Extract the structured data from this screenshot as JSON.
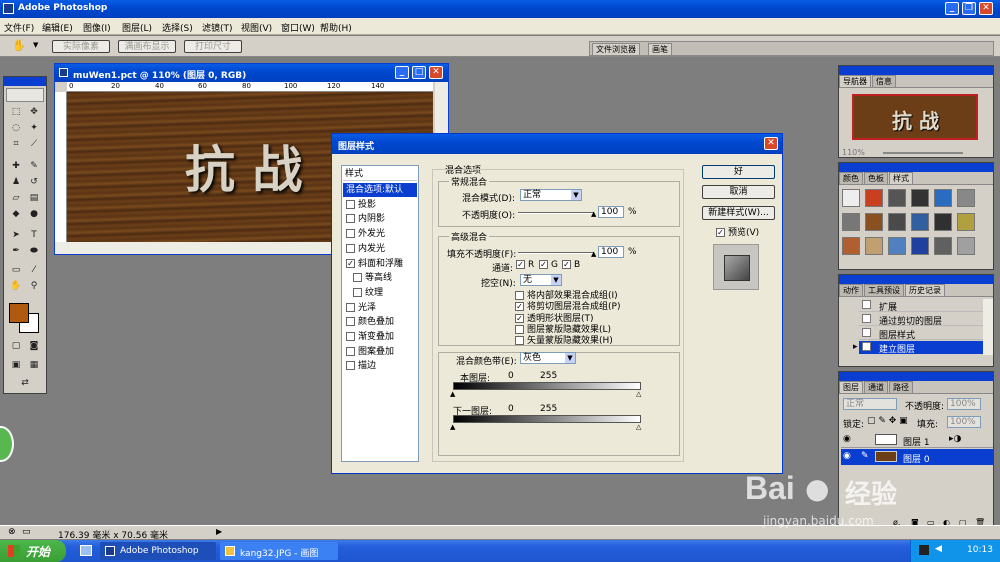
{
  "app": {
    "title": "Adobe Photoshop"
  },
  "menu": [
    "文件(F)",
    "编辑(E)",
    "图像(I)",
    "图层(L)",
    "选择(S)",
    "滤镜(T)",
    "视图(V)",
    "窗口(W)",
    "帮助(H)"
  ],
  "options": {
    "actual_pixels": "实际像素",
    "fit_screen": "满画布显示",
    "print_size": "打印尺寸",
    "file_browser": "文件浏览器",
    "brushes": "画笔"
  },
  "document": {
    "title": "muWen1.pct @ 110% (图层 0, RGB)",
    "ruler": [
      "0",
      "20",
      "40",
      "60",
      "80",
      "100",
      "120",
      "140"
    ],
    "text": "抗 战"
  },
  "dialog": {
    "title": "图层样式",
    "styles_header": "样式",
    "styles": [
      {
        "label": "混合选项:默认",
        "checked": null,
        "selected": true,
        "indent": false
      },
      {
        "label": "投影",
        "checked": false,
        "selected": false,
        "indent": false
      },
      {
        "label": "内阴影",
        "checked": false,
        "selected": false,
        "indent": false
      },
      {
        "label": "外发光",
        "checked": false,
        "selected": false,
        "indent": false
      },
      {
        "label": "内发光",
        "checked": false,
        "selected": false,
        "indent": false
      },
      {
        "label": "斜面和浮雕",
        "checked": true,
        "selected": false,
        "indent": false
      },
      {
        "label": "等高线",
        "checked": false,
        "selected": false,
        "indent": true
      },
      {
        "label": "纹理",
        "checked": false,
        "selected": false,
        "indent": true
      },
      {
        "label": "光泽",
        "checked": false,
        "selected": false,
        "indent": false
      },
      {
        "label": "颜色叠加",
        "checked": false,
        "selected": false,
        "indent": false
      },
      {
        "label": "渐变叠加",
        "checked": false,
        "selected": false,
        "indent": false
      },
      {
        "label": "图案叠加",
        "checked": false,
        "selected": false,
        "indent": false
      },
      {
        "label": "描边",
        "checked": false,
        "selected": false,
        "indent": false
      }
    ],
    "blend_options": "混合选项",
    "general_blending": "常规混合",
    "blend_mode_label": "混合模式(D):",
    "blend_mode": "正常",
    "opacity_label": "不透明度(O):",
    "opacity": "100",
    "advanced_blending": "高级混合",
    "fill_opacity_label": "填充不透明度(F):",
    "fill_opacity": "100",
    "percent": "%",
    "channels_label": "通道:",
    "channels": [
      "R",
      "G",
      "B"
    ],
    "knockout_label": "挖空(N):",
    "knockout": "无",
    "adv_options": [
      {
        "label": "将内部效果混合成组(I)",
        "checked": false
      },
      {
        "label": "将剪切图层混合成组(P)",
        "checked": true
      },
      {
        "label": "透明形状图层(T)",
        "checked": true
      },
      {
        "label": "图层蒙版隐藏效果(L)",
        "checked": false
      },
      {
        "label": "矢量蒙版隐藏效果(H)",
        "checked": false
      }
    ],
    "blend_if_label": "混合颜色带(E):",
    "blend_if": "灰色",
    "this_layer": "本图层:",
    "underlying_layer": "下一图层:",
    "range_low": "0",
    "range_high": "255",
    "ok": "好",
    "cancel": "取消",
    "new_style": "新建样式(W)...",
    "preview": "预览(V)"
  },
  "navigator": {
    "tabs": [
      "导航器",
      "信息"
    ],
    "zoom": "110%",
    "thumb_text": "抗 战"
  },
  "swatches": {
    "tabs": [
      "颜色",
      "色板",
      "样式"
    ]
  },
  "history": {
    "tabs": [
      "动作",
      "工具预设",
      "历史记录"
    ],
    "items": [
      "扩展",
      "通过剪切的图层",
      "图层样式",
      "建立图层"
    ]
  },
  "layers": {
    "tabs": [
      "图层",
      "通道",
      "路径"
    ],
    "mode": "正常",
    "opacity_label": "不透明度:",
    "opacity": "100%",
    "lock_label": "锁定:",
    "fill_label": "填充:",
    "fill": "100%",
    "items": [
      "图层 1",
      "图层 0"
    ]
  },
  "status": {
    "size": "176.39 毫米 x 70.56 毫米"
  },
  "taskbar": {
    "start": "开始",
    "items": [
      "Adobe Photoshop",
      "kang32.JPG - 画图"
    ],
    "clock": "10:13"
  },
  "watermark": {
    "brand": "Bai",
    "cn": "经验",
    "url": "jingyan.baidu.com"
  },
  "colors": {
    "xp_blue": "#0a5ce6",
    "taskbar_green": "#3a9e34",
    "foreground": "#b05a10",
    "selection": "#0a3ed0"
  }
}
